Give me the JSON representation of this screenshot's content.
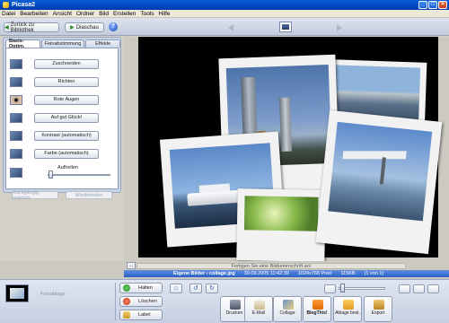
{
  "window": {
    "title": "Picasa2"
  },
  "menu": [
    "Datei",
    "Bearbeiten",
    "Ansicht",
    "Ordner",
    "Bild",
    "Erstellen",
    "Tools",
    "Hilfe"
  ],
  "toolbar": {
    "back_label": "Zurück zu Bibliothek",
    "slideshow_label": "Diaschau",
    "help_glyph": "?"
  },
  "left_panel": {
    "tabs": [
      "Basis-Optim.",
      "Feinabstimmung",
      "Effekte"
    ],
    "fixes": [
      "Zuschneiden",
      "Richten",
      "Rote Augen",
      "Auf gut Glück!",
      "Kontrast (automatisch)",
      "Farbe (automatisch)"
    ],
    "slider_label": "Aufhellen",
    "undo_label": "Rückgängig machen",
    "redo_label": "Wiederholen"
  },
  "caption": {
    "placeholder": "Fertigen Sie eine Bildunterschrift an!",
    "small_tag": "..."
  },
  "info": {
    "path": "Eigene Bilder › collage.jpg",
    "date": "30.09.2005 11:42:39",
    "dimensions": "1024x768 Pixel",
    "size": "115KB",
    "position": "(1 von 1)"
  },
  "tray": {
    "label": "Fotoablage",
    "hold_label": "Halten",
    "delete_label": "Löschen",
    "label_label": "Label",
    "actions": [
      "Drucken",
      "E-Mail",
      "Collage",
      "BlogThis!",
      "Ablage best.",
      "Export"
    ]
  },
  "colors": {
    "titlebar": "#0048c0",
    "infobar": "#2c60c4",
    "canvas": "#000000"
  }
}
